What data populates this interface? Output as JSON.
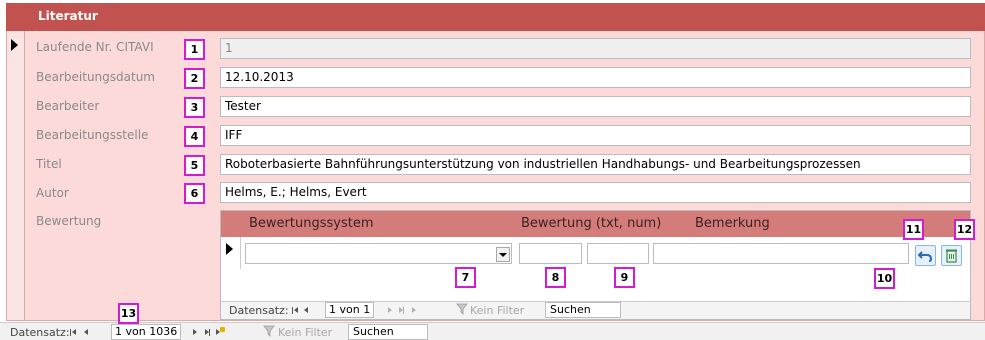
{
  "form": {
    "title": "Literatur",
    "fields": [
      {
        "label": "Laufende Nr. CITAVI",
        "value": "1",
        "callout": "1"
      },
      {
        "label": "Bearbeitungsdatum",
        "value": "12.10.2013",
        "callout": "2"
      },
      {
        "label": "Bearbeiter",
        "value": "Tester",
        "callout": "3"
      },
      {
        "label": "Bearbeitungsstelle",
        "value": "IFF",
        "callout": "4"
      },
      {
        "label": "Titel",
        "value": "Roboterbasierte Bahnführungsunterstützung von industriellen Handhabungs- und Bearbeitungsprozessen",
        "callout": "5"
      },
      {
        "label": "Autor",
        "value": "Helms, E.; Helms, Evert",
        "callout": "6"
      }
    ],
    "bewertung_label": "Bewertung"
  },
  "subform": {
    "col_system": "Bewertungssystem",
    "col_rating": "Bewertung (txt, num)",
    "col_remark": "Bemerkung",
    "callouts": {
      "combo": "7",
      "txt": "8",
      "num": "9",
      "remark": "10",
      "undo": "11",
      "delete": "12"
    },
    "nav": {
      "label": "Datensatz:",
      "record": "1 von 1",
      "filter": "Kein Filter",
      "search": "Suchen"
    }
  },
  "main_nav": {
    "label": "Datensatz:",
    "record": "1 von 1036",
    "filter": "Kein Filter",
    "search": "Suchen",
    "callout": "13"
  },
  "icons": {
    "undo": "undo-icon",
    "delete": "delete-icon",
    "record_selector": "record-selector-arrow-icon"
  },
  "colors": {
    "title_bar": "#c1524f",
    "form_bg": "#fcdada",
    "sub_header": "#d47c7a",
    "callout_border": "#d21bd2"
  }
}
